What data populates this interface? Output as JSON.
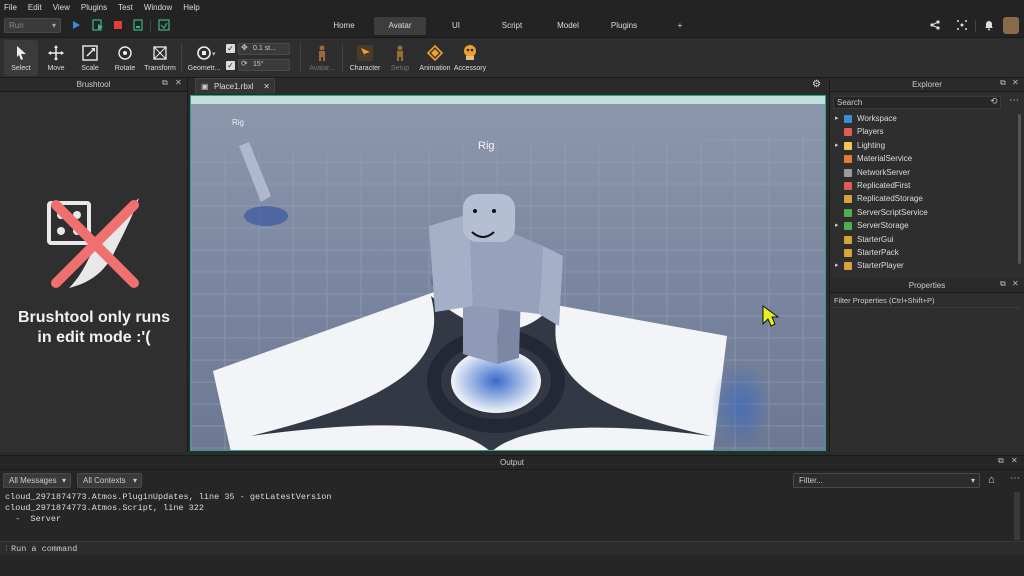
{
  "menu": [
    "File",
    "Edit",
    "View",
    "Plugins",
    "Test",
    "Window",
    "Help"
  ],
  "run_selector": "Run",
  "tabs": [
    {
      "label": "Home",
      "active": false
    },
    {
      "label": "Avatar",
      "active": true
    },
    {
      "label": "UI",
      "active": false
    },
    {
      "label": "Script",
      "active": false
    },
    {
      "label": "Model",
      "active": false
    },
    {
      "label": "Plugins",
      "active": false
    },
    {
      "label": "+",
      "active": false
    }
  ],
  "tools": {
    "select": "Select",
    "move": "Move",
    "scale": "Scale",
    "rotate": "Rotate",
    "transform": "Transform",
    "geometry": "Geometr...",
    "avatar": "Avatar...",
    "character": "Character",
    "setup": "Setup",
    "animation": "Animation",
    "accessory": "Accessory"
  },
  "snap": {
    "move_value": "0.1 st...",
    "rotate_value": "15°"
  },
  "brushtool": {
    "title": "Brushtool",
    "message_line1": "Brushtool only runs",
    "message_line2": "in edit mode :'("
  },
  "viewport": {
    "doc_tab": "Place1.rbxl",
    "label_rig_main": "Rig",
    "label_rig_small": "Rig"
  },
  "explorer": {
    "title": "Explorer",
    "search_placeholder": "Search",
    "items": [
      {
        "label": "Workspace",
        "expandable": true,
        "icon_color": "#3b8fd9"
      },
      {
        "label": "Players",
        "expandable": false,
        "icon_color": "#e05a5a"
      },
      {
        "label": "Lighting",
        "expandable": true,
        "icon_color": "#f2c94c"
      },
      {
        "label": "MaterialService",
        "expandable": false,
        "icon_color": "#e07b39"
      },
      {
        "label": "NetworkServer",
        "expandable": false,
        "icon_color": "#999999"
      },
      {
        "label": "ReplicatedFirst",
        "expandable": false,
        "icon_color": "#e05a5a"
      },
      {
        "label": "ReplicatedStorage",
        "expandable": false,
        "icon_color": "#d9a23b"
      },
      {
        "label": "ServerScriptService",
        "expandable": false,
        "icon_color": "#4caf50"
      },
      {
        "label": "ServerStorage",
        "expandable": true,
        "icon_color": "#4caf50"
      },
      {
        "label": "StarterGui",
        "expandable": false,
        "icon_color": "#d9a23b"
      },
      {
        "label": "StarterPack",
        "expandable": false,
        "icon_color": "#d9a23b"
      },
      {
        "label": "StarterPlayer",
        "expandable": true,
        "icon_color": "#d9a23b"
      }
    ]
  },
  "properties": {
    "title": "Properties",
    "filter_placeholder": "Filter Properties (Ctrl+Shift+P)"
  },
  "output": {
    "title": "Output",
    "messages_filter": "All Messages",
    "contexts_filter": "All Contexts",
    "filter_placeholder": "Filter...",
    "lines": [
      "cloud_2971874773.Atmos.PluginUpdates, line 35 - getLatestVersion",
      "cloud_2971874773.Atmos.Script, line 322",
      "  -  Server"
    ],
    "command_placeholder": "Run a command"
  },
  "colors": {
    "accent_teal": "#2aa58a",
    "cursor_yellow": "#e8f020",
    "stop_red": "#e03c3c",
    "play_blue": "#3c8be0"
  }
}
